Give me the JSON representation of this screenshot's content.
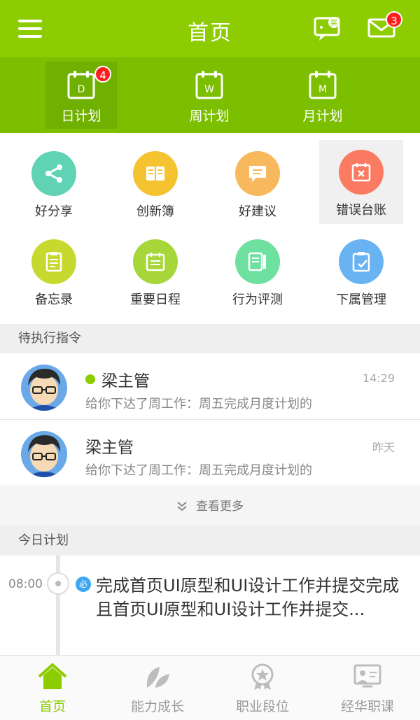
{
  "header": {
    "title": "首页",
    "chat_glyph": "奖",
    "mail_badge": "3"
  },
  "plans": [
    {
      "label": "日计划",
      "letter": "D",
      "badge": "4",
      "active": true
    },
    {
      "label": "周计划",
      "letter": "W",
      "badge": "",
      "active": false
    },
    {
      "label": "月计划",
      "letter": "M",
      "badge": "",
      "active": false
    }
  ],
  "grid": [
    {
      "label": "好分享",
      "icon": "share-icon",
      "color": "#5fd3b3"
    },
    {
      "label": "创新簿",
      "icon": "book-icon",
      "color": "#f5c330"
    },
    {
      "label": "好建议",
      "icon": "comment-icon",
      "color": "#f8b85e"
    },
    {
      "label": "错误台账",
      "icon": "error-calendar-icon",
      "color": "#fb7a62"
    },
    {
      "label": "备忘录",
      "icon": "memo-icon",
      "color": "#c7d92f"
    },
    {
      "label": "重要日程",
      "icon": "schedule-icon",
      "color": "#a6d63a"
    },
    {
      "label": "行为评测",
      "icon": "evaluation-icon",
      "color": "#6ee0a0"
    },
    {
      "label": "下属管理",
      "icon": "subordinate-icon",
      "color": "#6ab3f3"
    }
  ],
  "pending": {
    "title": "待执行指令",
    "messages": [
      {
        "name": "梁主管",
        "time": "14:29",
        "preview": "给你下达了周工作：周五完成月度计划的",
        "unread": true
      },
      {
        "name": "梁主管",
        "time": "昨天",
        "preview": "给你下达了周工作：周五完成月度计划的",
        "unread": false
      }
    ],
    "more": "查看更多"
  },
  "today": {
    "title": "今日计划",
    "tasks": [
      {
        "time": "08:00",
        "tag": "必",
        "text": "完成首页UI原型和UI设计工作并提交完成且首页UI原型和UI设计工作并提交..."
      }
    ]
  },
  "tabs": [
    {
      "label": "首页",
      "icon": "home-icon",
      "active": true
    },
    {
      "label": "能力成长",
      "icon": "leaf-icon",
      "active": false
    },
    {
      "label": "职业段位",
      "icon": "medal-icon",
      "active": false
    },
    {
      "label": "经华职课",
      "icon": "classroom-icon",
      "active": false
    }
  ],
  "colors": {
    "brand": "#8ccc00",
    "brand_dark": "#7bbf00",
    "badge": "#ff1e1e",
    "tag": "#3ba7f0"
  }
}
